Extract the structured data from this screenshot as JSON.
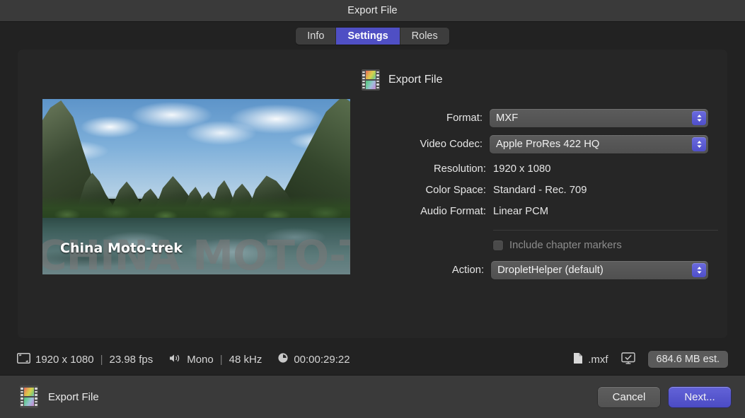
{
  "window": {
    "title": "Export File"
  },
  "tabs": [
    {
      "label": "Info",
      "active": false
    },
    {
      "label": "Settings",
      "active": true
    },
    {
      "label": "Roles",
      "active": false
    }
  ],
  "preview": {
    "ghost_text": "CHINA MOTO-TREK",
    "title": "China Moto-trek"
  },
  "settings": {
    "header_icon": "filmstrip-icon",
    "header_label": "Export File",
    "format": {
      "label": "Format:",
      "value": "MXF",
      "stepper_icon": "chevron-up-down-icon"
    },
    "video_codec": {
      "label": "Video Codec:",
      "value": "Apple ProRes 422 HQ",
      "stepper_icon": "chevron-up-down-icon"
    },
    "resolution": {
      "label": "Resolution:",
      "value": "1920 x 1080"
    },
    "color_space": {
      "label": "Color Space:",
      "value": "Standard - Rec. 709"
    },
    "audio_format": {
      "label": "Audio Format:",
      "value": "Linear PCM"
    },
    "include_chapter_markers": {
      "label": "Include chapter markers",
      "checked": false,
      "enabled": false
    },
    "action": {
      "label": "Action:",
      "value": "DropletHelper (default)",
      "stepper_icon": "chevron-up-down-icon"
    }
  },
  "status": {
    "video_icon": "frame-size-icon",
    "resolution": "1920 x 1080",
    "separator": "|",
    "fps": "23.98 fps",
    "audio_icon": "speaker-icon",
    "channels": "Mono",
    "sample_rate": "48 kHz",
    "clock_icon": "clock-icon",
    "duration": "00:00:29:22",
    "file_icon": "document-icon",
    "extension": ".mxf",
    "display_icon": "display-check-icon",
    "size_estimate": "684.6 MB est."
  },
  "bottom": {
    "icon": "filmstrip-icon",
    "label": "Export File",
    "cancel_label": "Cancel",
    "next_label": "Next..."
  },
  "colors": {
    "accent": "#4f4fc4",
    "window_bg": "#222222",
    "titlebar_bg": "#3a3a3a",
    "panel_bg": "#262626",
    "field_bg": "#565656",
    "text": "#e6e6e6",
    "disabled_text": "#8c8c8c"
  }
}
